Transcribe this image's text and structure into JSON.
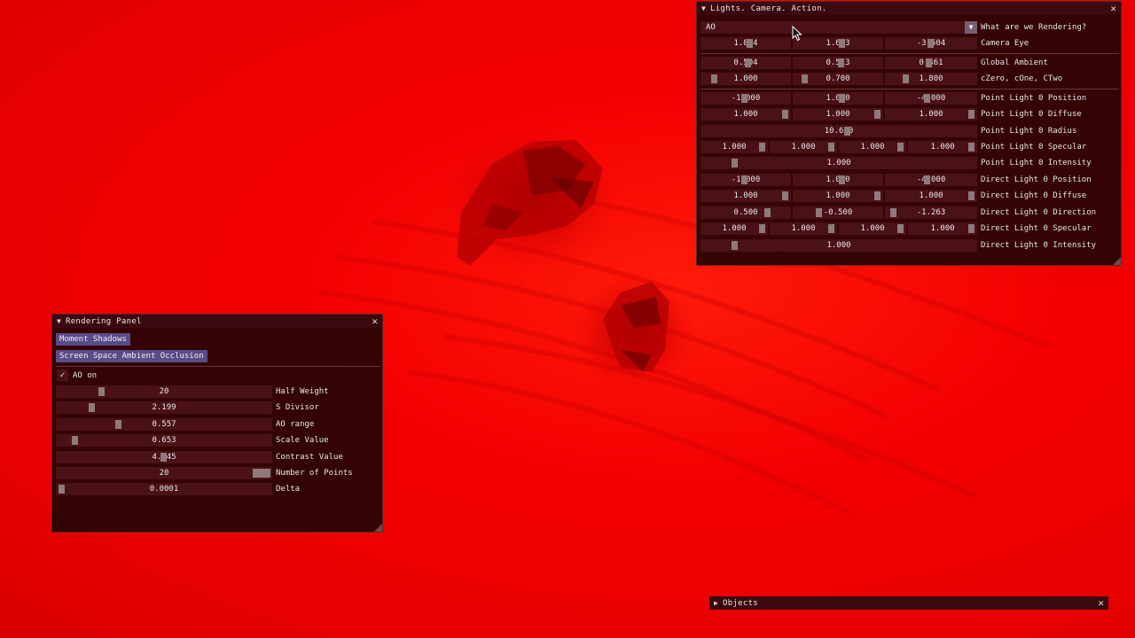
{
  "colors": {
    "background": "#ee0000",
    "panel": "#260404",
    "title_bar": "#3b0a10",
    "frame": "#4a1117",
    "grab": "#8e7a7a",
    "header": "#5a4a88"
  },
  "lights_window": {
    "title": "Lights. Camera. Action.",
    "combo": {
      "value": "AO",
      "label": "What are we Rendering?"
    },
    "rows": [
      {
        "label": "Camera Eye",
        "values": [
          "1.874",
          "1.643",
          "-3.504"
        ]
      },
      {
        "label": "Global Ambient",
        "values": [
          "0.504",
          "0.513",
          "0.461"
        ]
      },
      {
        "label": "cZero, cOne, CTwo",
        "values": [
          "1.000",
          "0.700",
          "1.800"
        ]
      },
      {
        "label": "Point Light 0 Position",
        "values": [
          "-1.000",
          "1.000",
          "-4.000"
        ]
      },
      {
        "label": "Point Light 0 Diffuse",
        "values": [
          "1.000",
          "1.000",
          "1.000"
        ]
      },
      {
        "label": "Point Light 0 Radius",
        "values": [
          "10.610"
        ]
      },
      {
        "label": "Point Light 0 Specular",
        "values": [
          "1.000",
          "1.000",
          "1.000",
          "1.000"
        ]
      },
      {
        "label": "Point Light 0 Intensity",
        "values": [
          "1.000"
        ]
      },
      {
        "label": "Direct Light 0 Position",
        "values": [
          "-1.000",
          "1.000",
          "-4.000"
        ]
      },
      {
        "label": "Direct Light 0 Diffuse",
        "values": [
          "1.000",
          "1.000",
          "1.000"
        ]
      },
      {
        "label": "Direct Light 0 Direction",
        "values": [
          "0.500",
          "-0.500",
          "-1.263"
        ]
      },
      {
        "label": "Direct Light 0 Specular",
        "values": [
          "1.000",
          "1.000",
          "1.000",
          "1.000"
        ]
      },
      {
        "label": "Direct Light 0 Intensity",
        "values": [
          "1.000"
        ]
      }
    ]
  },
  "rendering_panel": {
    "title": "Rendering Panel",
    "headers": [
      "Moment Shadows",
      "Screen Space Ambient Occlusion"
    ],
    "checkbox": {
      "label": "AO on",
      "checked": true,
      "mark": "✓"
    },
    "sliders": [
      {
        "label": "Half Weight",
        "value": "20"
      },
      {
        "label": "S Divisor",
        "value": "2.199"
      },
      {
        "label": "AO range",
        "value": "0.557"
      },
      {
        "label": "Scale Value",
        "value": "0.653"
      },
      {
        "label": "Contrast Value",
        "value": "4.845"
      },
      {
        "label": "Number of Points",
        "value": "20"
      },
      {
        "label": "Delta",
        "value": "0.0001"
      }
    ]
  },
  "objects_window": {
    "title": "Objects"
  },
  "icons": {
    "collapse": "▼",
    "expand": "▶",
    "close": "✕",
    "combo_arrow": "▼"
  }
}
